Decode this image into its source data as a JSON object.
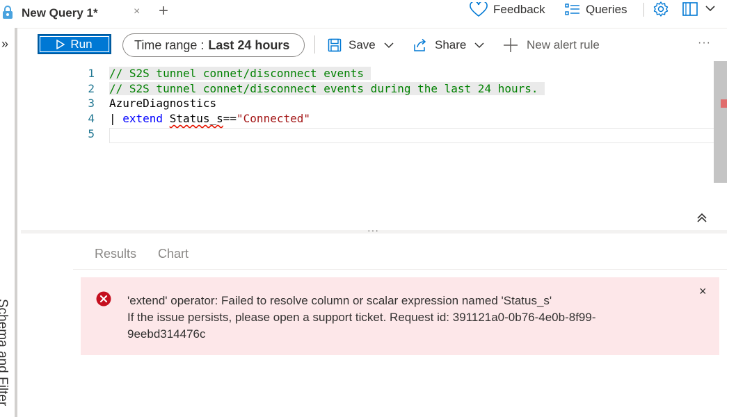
{
  "tab": {
    "title": "New Query 1*",
    "close": "×",
    "add": "+"
  },
  "header": {
    "feedback": "Feedback",
    "queries": "Queries"
  },
  "sidebar": {
    "expand": "»",
    "label": "Schema and Filter"
  },
  "toolbar": {
    "run": "Run",
    "time_range_label": "Time range :",
    "time_range_value": "Last 24 hours",
    "save": "Save",
    "share": "Share",
    "new_alert_rule": "New alert rule",
    "more": "···"
  },
  "editor": {
    "line_numbers": [
      "1",
      "2",
      "3",
      "4",
      "5"
    ],
    "lines": {
      "l1": "// S2S tunnel connet/disconnect events ",
      "l2": "// S2S tunnel connet/disconnect events during the last 24 hours. ",
      "l3": "AzureDiagnostics",
      "l4_pipe": "| ",
      "l4_kw": "extend",
      "l4_sp": " ",
      "l4_ident": "Status_s",
      "l4_op": "==",
      "l4_str": "\"Connected\""
    },
    "grip": "···"
  },
  "results": {
    "tabs": [
      "Results",
      "Chart"
    ],
    "error": {
      "line1": "'extend' operator: Failed to resolve column or scalar expression named 'Status_s'",
      "line2": "If the issue persists, please open a support ticket. Request id: 391121a0-0b76-4e0b-8f99-",
      "line3": "9eebd314476c",
      "close": "×"
    }
  },
  "colors": {
    "accent": "#0078d4",
    "error_bg": "#fde7e9",
    "error_icon": "#c50f1f"
  }
}
